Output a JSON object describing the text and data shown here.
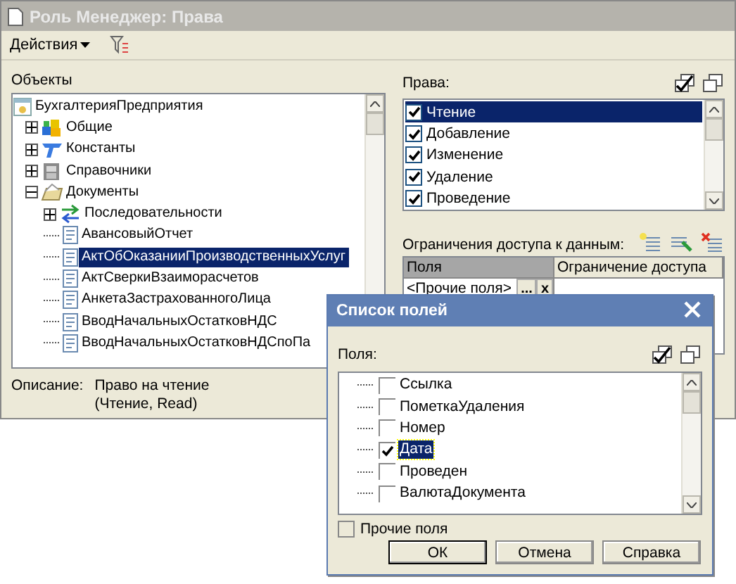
{
  "window": {
    "title": "Роль Менеджер: Права"
  },
  "toolbar": {
    "actions_menu": "Действия"
  },
  "objects": {
    "label": "Объекты",
    "tree": [
      {
        "label": "БухгалтерияПредприятия",
        "kind": "config",
        "selected": false,
        "children": [
          {
            "label": "Общие",
            "kind": "common",
            "expanded": false,
            "selected": false
          },
          {
            "label": "Константы",
            "kind": "constants",
            "expanded": false,
            "selected": false
          },
          {
            "label": "Справочники",
            "kind": "catalogs",
            "expanded": false,
            "selected": false
          },
          {
            "label": "Документы",
            "kind": "documents",
            "expanded": true,
            "selected": false,
            "children": [
              {
                "label": "Последовательности",
                "kind": "sequences",
                "expanded": false,
                "selected": false
              },
              {
                "label": "АвансовыйОтчет",
                "kind": "document",
                "selected": false
              },
              {
                "label": "АктОбОказанииПроизводственныхУслуг",
                "kind": "document",
                "selected": true
              },
              {
                "label": "АктСверкиВзаиморасчетов",
                "kind": "document",
                "selected": false
              },
              {
                "label": "АнкетаЗастрахованногоЛица",
                "kind": "document",
                "selected": false
              },
              {
                "label": "ВводНачальныхОстатковНДС",
                "kind": "document",
                "selected": false
              },
              {
                "label": "ВводНачальныхОстатковНДСпоПа",
                "kind": "document",
                "selected": false
              }
            ]
          }
        ]
      }
    ]
  },
  "description": {
    "label": "Описание:",
    "lines": [
      "Право на чтение",
      "(Чтение, Read)"
    ]
  },
  "rights": {
    "label": "Права:",
    "items": [
      {
        "label": "Чтение",
        "checked": true,
        "selected": true
      },
      {
        "label": "Добавление",
        "checked": true,
        "selected": false
      },
      {
        "label": "Изменение",
        "checked": true,
        "selected": false
      },
      {
        "label": "Удаление",
        "checked": true,
        "selected": false
      },
      {
        "label": "Проведение",
        "checked": true,
        "selected": false
      }
    ]
  },
  "restrictions": {
    "label": "Ограничения доступа к данным:",
    "columns": [
      "Поля",
      "Ограничение доступа"
    ],
    "rows": [
      {
        "field": "<Прочие поля>",
        "buttons": [
          "...",
          "x"
        ]
      }
    ]
  },
  "dialog": {
    "title": "Список полей",
    "fields_label": "Поля:",
    "fields": [
      {
        "label": "Ссылка",
        "checked": false,
        "selected": false
      },
      {
        "label": "ПометкаУдаления",
        "checked": false,
        "selected": false
      },
      {
        "label": "Номер",
        "checked": false,
        "selected": false
      },
      {
        "label": "Дата",
        "checked": true,
        "selected": true
      },
      {
        "label": "Проведен",
        "checked": false,
        "selected": false
      },
      {
        "label": "ВалютаДокумента",
        "checked": false,
        "selected": false
      }
    ],
    "other_fields": {
      "label": "Прочие поля",
      "checked": false
    },
    "buttons": [
      {
        "label": "ОК",
        "default": true
      },
      {
        "label": "Отмена",
        "default": false
      },
      {
        "label": "Справка",
        "default": false
      }
    ]
  }
}
